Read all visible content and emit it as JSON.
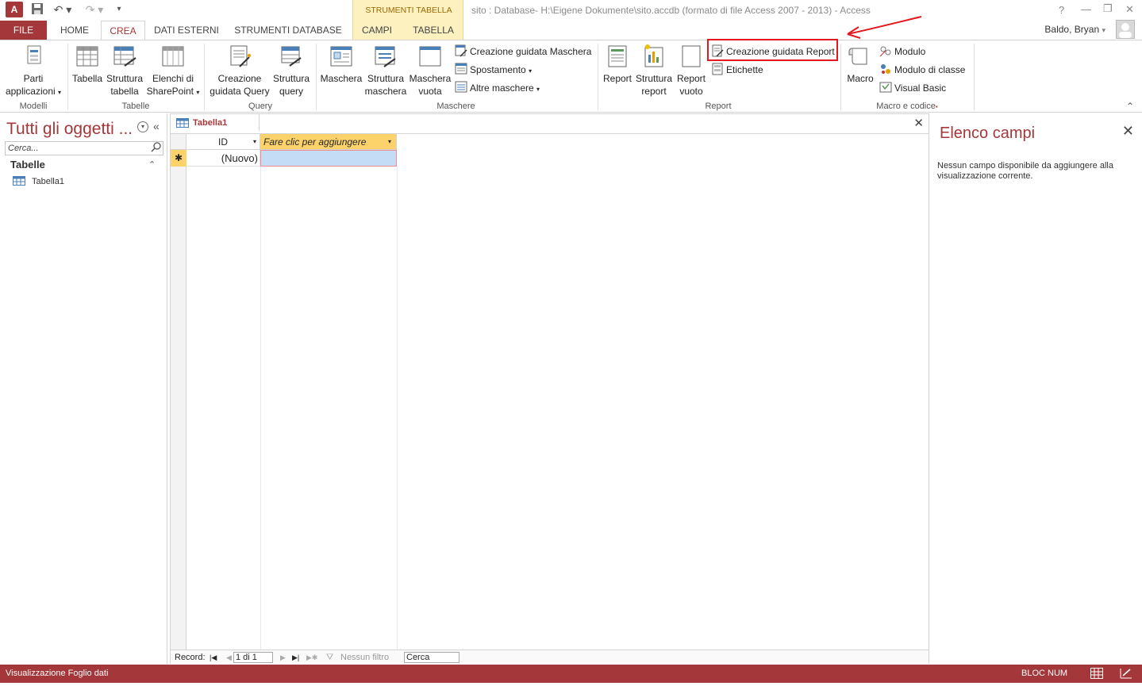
{
  "title_bar": {
    "doc_title": "sito : Database- H:\\Eigene Dokumente\\sito.accdb (formato di file Access 2007 - 2013) - Access",
    "context_group": "STRUMENTI TABELLA",
    "help": "?",
    "minimize": "—",
    "restore": "❐",
    "close": "✕"
  },
  "tabs": {
    "file": "FILE",
    "home": "HOME",
    "crea": "CREA",
    "dati_esterni": "DATI ESTERNI",
    "strumenti_db": "STRUMENTI DATABASE",
    "campi": "CAMPI",
    "tabella": "TABELLA"
  },
  "user": "Baldo, Bryan",
  "ribbon": {
    "modelli": {
      "label": "Modelli",
      "parti": "Parti",
      "applicazioni": "applicazioni"
    },
    "tabelle": {
      "label": "Tabelle",
      "tabella": "Tabella",
      "struttura_1": "Struttura",
      "struttura_2": "tabella",
      "elenchi_1": "Elenchi di",
      "elenchi_2": "SharePoint"
    },
    "query": {
      "label": "Query",
      "creazione_1": "Creazione",
      "creazione_2": "guidata Query",
      "struttura_1": "Struttura",
      "struttura_2": "query"
    },
    "maschere": {
      "label": "Maschere",
      "maschera": "Maschera",
      "struttura_1": "Struttura",
      "struttura_2": "maschera",
      "vuota_1": "Maschera",
      "vuota_2": "vuota",
      "creazione": "Creazione guidata Maschera",
      "spostamento": "Spostamento",
      "altre": "Altre maschere"
    },
    "report": {
      "label": "Report",
      "report": "Report",
      "struttura_1": "Struttura",
      "struttura_2": "report",
      "vuoto_1": "Report",
      "vuoto_2": "vuoto",
      "creazione": "Creazione guidata Report",
      "etichette": "Etichette"
    },
    "macro": {
      "label": "Macro e codice",
      "macro": "Macro",
      "modulo": "Modulo",
      "modulo_classe": "Modulo di classe",
      "visual_basic": "Visual Basic"
    }
  },
  "nav_pane": {
    "title": "Tutti gli oggetti ...",
    "search_placeholder": "Cerca...",
    "category": "Tabelle",
    "items": [
      "Tabella1"
    ]
  },
  "document": {
    "tab": "Tabella1",
    "columns": [
      "ID",
      "Fare clic per aggiungere"
    ],
    "new_row_marker": "✱",
    "new_row_id": "(Nuovo)"
  },
  "record_nav": {
    "label": "Record:",
    "position": "1 di 1",
    "filter": "Nessun filtro",
    "search": "Cerca"
  },
  "field_list": {
    "title": "Elenco campi",
    "message": "Nessun campo disponibile da aggiungere alla visualizzazione corrente."
  },
  "status_bar": {
    "view": "Visualizzazione Foglio dati",
    "num_lock": "BLOC NUM"
  },
  "colors": {
    "accent": "#a4373a",
    "context": "#fdf1c0",
    "highlight": "#e4171c",
    "new_row": "#fcd36b"
  }
}
